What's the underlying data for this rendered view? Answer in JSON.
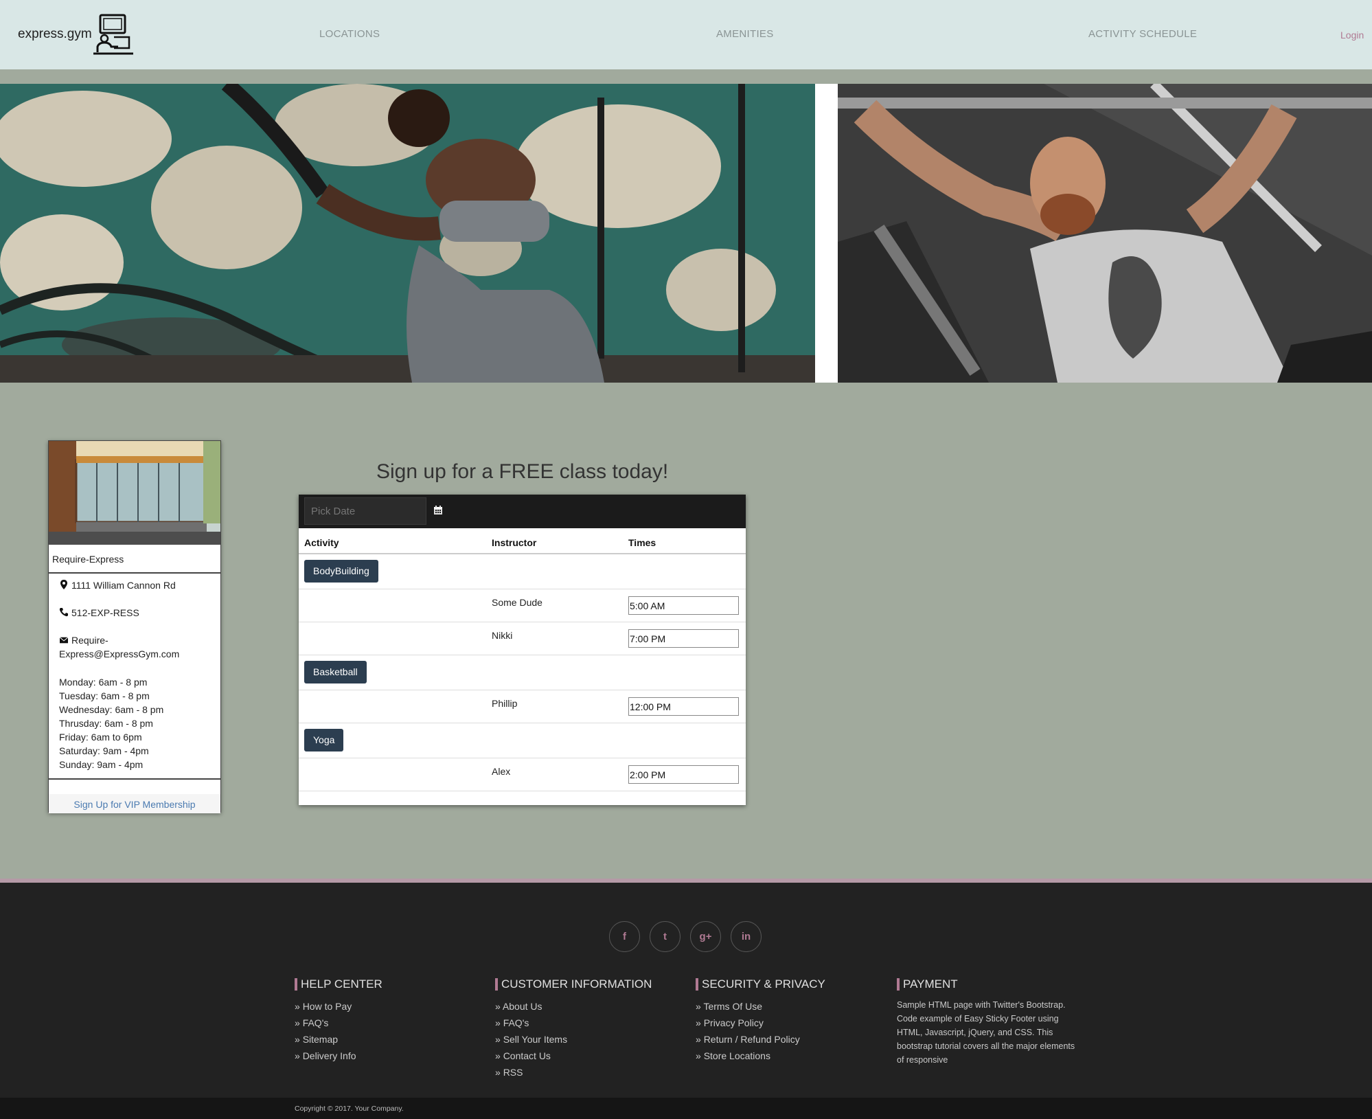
{
  "navbar": {
    "brand": "express.gym",
    "links": [
      "LOCATIONS",
      "AMENITIES",
      "ACTIVITY SCHEDULE"
    ],
    "login": "Login"
  },
  "location": {
    "name": "Require-Express",
    "address": "1111 William Cannon Rd",
    "phone": "512-EXP-RESS",
    "email_line1": "Require-",
    "email_line2": "Express@ExpressGym.com",
    "hours": [
      "Monday: 6am - 8 pm",
      "Tuesday: 6am - 8 pm",
      "Wednesday: 6am - 8 pm",
      "Thrusday: 6am - 8 pm",
      "Friday: 6am to 6pm",
      "Saturday: 9am - 4pm",
      "Sunday: 9am - 4pm"
    ],
    "vip_link": "Sign Up for VIP Membership"
  },
  "signup": {
    "title": "Sign up for a FREE class today!",
    "date_placeholder": "Pick Date",
    "headers": {
      "activity": "Activity",
      "instructor": "Instructor",
      "times": "Times"
    },
    "activities": [
      {
        "name": "BodyBuilding",
        "sessions": [
          {
            "instructor": "Some Dude",
            "time": "5:00 AM"
          },
          {
            "instructor": "Nikki",
            "time": "7:00 PM"
          }
        ]
      },
      {
        "name": "Basketball",
        "sessions": [
          {
            "instructor": "Phillip",
            "time": "12:00 PM"
          }
        ]
      },
      {
        "name": "Yoga",
        "sessions": [
          {
            "instructor": "Alex",
            "time": "2:00 PM"
          }
        ]
      }
    ]
  },
  "footer": {
    "social": [
      "facebook-icon",
      "twitter-icon",
      "google-plus-icon",
      "linkedin-icon"
    ],
    "social_glyphs": [
      "f",
      "t",
      "g+",
      "in"
    ],
    "columns": [
      {
        "title": "HELP CENTER",
        "links": [
          "How to Pay",
          "FAQ's",
          "Sitemap",
          "Delivery Info"
        ]
      },
      {
        "title": "CUSTOMER INFORMATION",
        "links": [
          "About Us",
          "FAQ's",
          "Sell Your Items",
          "Contact Us",
          "RSS"
        ]
      },
      {
        "title": "SECURITY & PRIVACY",
        "links": [
          "Terms Of Use",
          "Privacy Policy",
          "Return / Refund Policy",
          "Store Locations"
        ]
      },
      {
        "title": "PAYMENT",
        "text": "Sample HTML page with Twitter's Bootstrap. Code example of Easy Sticky Footer using HTML, Javascript, jQuery, and CSS. This bootstrap tutorial covers all the major elements of responsive"
      }
    ],
    "copyright": "Copyright © 2017. Your Company."
  },
  "colors": {
    "navbar_bg": "#d9e7e6",
    "page_bg": "#a1aa9d",
    "accent": "#b07a93",
    "button_bg": "#2c3e50",
    "footer_bg": "#222222"
  }
}
